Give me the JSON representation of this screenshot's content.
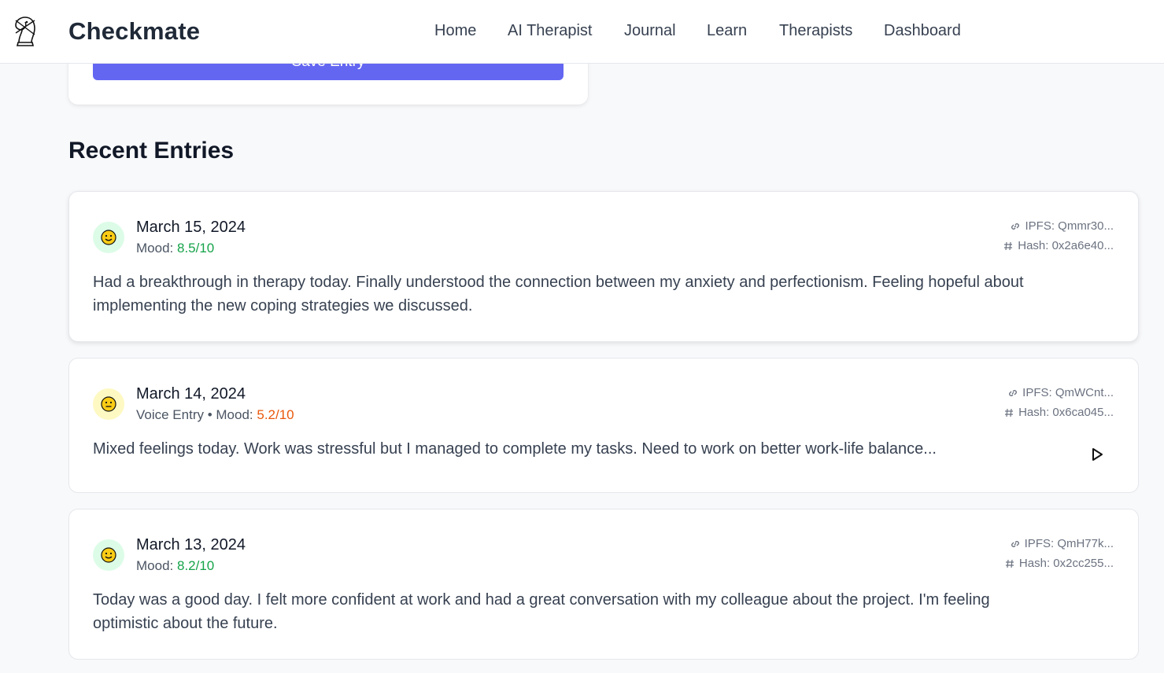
{
  "nav": {
    "brand": "Checkmate",
    "links": [
      "Home",
      "AI Therapist",
      "Journal",
      "Learn",
      "Therapists",
      "Dashboard"
    ]
  },
  "save_button_label": "Save Entry",
  "recent_title": "Recent Entries",
  "entries": [
    {
      "date": "March 15, 2024",
      "meta_prefix": "Mood: ",
      "mood": "8.5/10",
      "text": "Had a breakthrough in therapy today. Finally understood the connection between my anxiety and perfectionism. Feeling hopeful about implementing the new coping strategies we discussed.",
      "ipfs": "IPFS: Qmmr30...",
      "hash": "Hash: 0x2a6e40..."
    },
    {
      "date": "March 14, 2024",
      "meta_prefix": "Voice Entry • Mood: ",
      "mood": "5.2/10",
      "text": "Mixed feelings today. Work was stressful but I managed to complete my tasks. Need to work on better work-life balance...",
      "ipfs": "IPFS: QmWCnt...",
      "hash": "Hash: 0x6ca045..."
    },
    {
      "date": "March 13, 2024",
      "meta_prefix": "Mood: ",
      "mood": "8.2/10",
      "text": "Today was a good day. I felt more confident at work and had a great conversation with my colleague about the project. I'm feeling optimistic about the future.",
      "ipfs": "IPFS: QmH77k...",
      "hash": "Hash: 0x2cc255..."
    }
  ],
  "colors": {
    "accent": "#6366f1",
    "mood_good": "#16a34a",
    "mood_mid": "#ea580c",
    "happy_bg": "#dcfce7",
    "neutral_bg": "#fef9c3"
  }
}
